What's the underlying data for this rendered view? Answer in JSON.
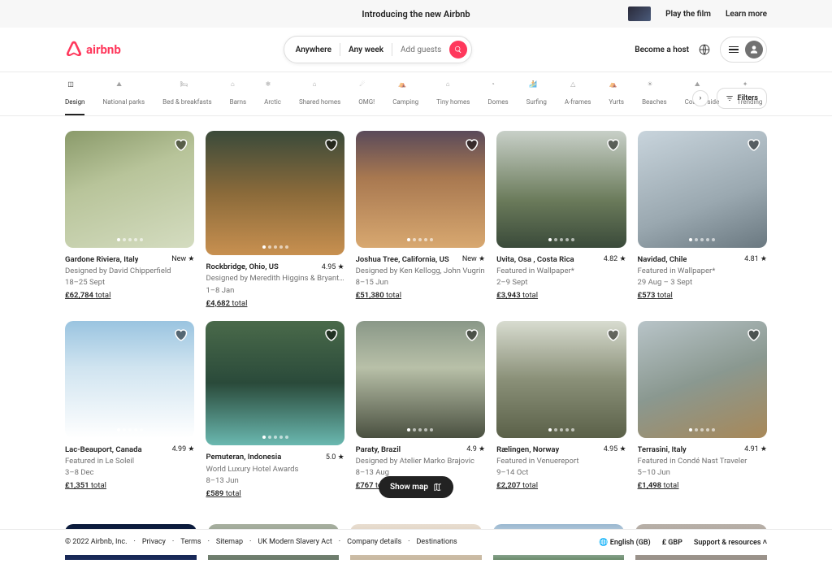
{
  "banner": {
    "title": "Introducing the new Airbnb",
    "play": "Play the film",
    "learn": "Learn more"
  },
  "logo": "airbnb",
  "search": {
    "where": "Anywhere",
    "when": "Any week",
    "who": "Add guests"
  },
  "nav": {
    "host": "Become a host"
  },
  "categories": [
    "Design",
    "National parks",
    "Bed & breakfasts",
    "Barns",
    "Arctic",
    "Shared homes",
    "OMG!",
    "Camping",
    "Tiny homes",
    "Domes",
    "Surfing",
    "A-frames",
    "Yurts",
    "Beaches",
    "Countryside",
    "Trending"
  ],
  "filters": "Filters",
  "cards": [
    {
      "title": "Gardone Riviera, Italy",
      "rating": "New",
      "sub": "Designed by David Chipperfield",
      "dates": "18–25 Sept",
      "price": "£62,784",
      "bg": "bg1"
    },
    {
      "title": "Rockbridge, Ohio, US",
      "rating": "4.95",
      "sub": "Designed by Meredith Higgins & Bryant…",
      "dates": "1–8 Jan",
      "price": "£4,682",
      "bg": "bg2"
    },
    {
      "title": "Joshua Tree, California, US",
      "rating": "New",
      "sub": "Designed by Ken Kellogg, John Vugrin",
      "dates": "8–15 Jun",
      "price": "£51,380",
      "bg": "bg3"
    },
    {
      "title": "Uvita, Osa , Costa Rica",
      "rating": "4.82",
      "sub": "Featured in Wallpaper*",
      "dates": "2–9 Sept",
      "price": "£3,943",
      "bg": "bg4"
    },
    {
      "title": "Navidad, Chile",
      "rating": "4.81",
      "sub": "Featured in Wallpaper*",
      "dates": "29 Aug – 3 Sept",
      "price": "£573",
      "bg": "bg5"
    },
    {
      "title": "Lac-Beauport, Canada",
      "rating": "4.99",
      "sub": "Featured in Le Soleil",
      "dates": "3–8 Dec",
      "price": "£1,351",
      "bg": "bg6"
    },
    {
      "title": "Pemuteran, Indonesia",
      "rating": "5.0",
      "sub": "World Luxury Hotel Awards",
      "dates": "8–13 Jun",
      "price": "£589",
      "bg": "bg7"
    },
    {
      "title": "Paraty, Brazil",
      "rating": "4.9",
      "sub": "Designed by Atelier Marko Brajovic",
      "dates": "8–13 Aug",
      "price": "£767",
      "bg": "bg8"
    },
    {
      "title": "Rælingen, Norway",
      "rating": "4.95",
      "sub": "Featured in Venuereport",
      "dates": "9–14 Oct",
      "price": "£2,207",
      "bg": "bg9"
    },
    {
      "title": "Terrasini, Italy",
      "rating": "4.91",
      "sub": "Featured in Condé Nast Traveler",
      "dates": "5–10 Jun",
      "price": "£1,498",
      "bg": "bg10"
    }
  ],
  "priceSuffix": "total",
  "showmap": "Show map",
  "peek": [
    "bg11",
    "bg12",
    "bg13",
    "bg14",
    "bg15"
  ],
  "footer": {
    "copyright": "© 2022 Airbnb, Inc.",
    "links": [
      "Privacy",
      "Terms",
      "Sitemap",
      "UK Modern Slavery Act",
      "Company details",
      "Destinations"
    ],
    "lang": "English (GB)",
    "currency": "£  GBP",
    "support": "Support & resources"
  }
}
